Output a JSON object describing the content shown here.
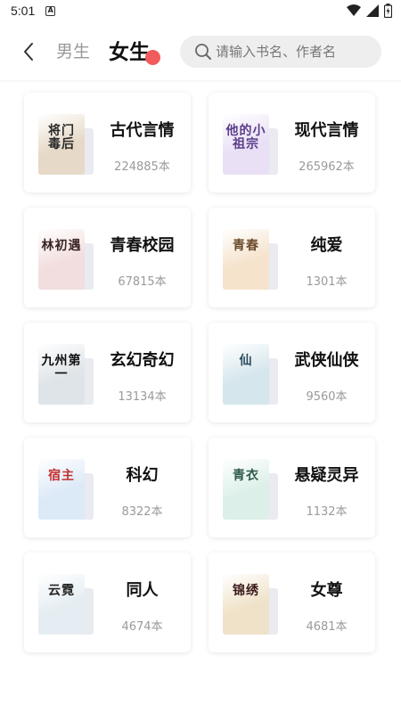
{
  "status_bar": {
    "time": "5:01",
    "notification_icon": "A"
  },
  "header": {
    "tabs": [
      {
        "label": "男生",
        "active": false
      },
      {
        "label": "女生",
        "active": true
      }
    ],
    "search_placeholder": "请输入书名、作者名"
  },
  "categories": [
    {
      "name": "古代言情",
      "count": "224885本",
      "cover_text": "将门\n毒后",
      "cover_bg": "#e6d9c7",
      "cover_ink": "#2a2a2a"
    },
    {
      "name": "现代言情",
      "count": "265962本",
      "cover_text": "他的小祖宗",
      "cover_bg": "#e9e0f5",
      "cover_ink": "#5b3d8a"
    },
    {
      "name": "青春校园",
      "count": "67815本",
      "cover_text": "林初遇",
      "cover_bg": "#f2dede",
      "cover_ink": "#3a2323"
    },
    {
      "name": "纯爱",
      "count": "1301本",
      "cover_text": "青春",
      "cover_bg": "#f5e3cc",
      "cover_ink": "#6a4a2a"
    },
    {
      "name": "玄幻奇幻",
      "count": "13134本",
      "cover_text": "九州第一",
      "cover_bg": "#dfe4e8",
      "cover_ink": "#111"
    },
    {
      "name": "武侠仙侠",
      "count": "9560本",
      "cover_text": "仙",
      "cover_bg": "#d5e6ec",
      "cover_ink": "#2b4a5a"
    },
    {
      "name": "科幻",
      "count": "8322本",
      "cover_text": "宿主",
      "cover_bg": "#dce9f7",
      "cover_ink": "#c12f2f"
    },
    {
      "name": "悬疑灵异",
      "count": "1132本",
      "cover_text": "青衣",
      "cover_bg": "#dcefe8",
      "cover_ink": "#2d5a4a"
    },
    {
      "name": "同人",
      "count": "4674本",
      "cover_text": "云霓",
      "cover_bg": "#e5edf2",
      "cover_ink": "#222"
    },
    {
      "name": "女尊",
      "count": "4681本",
      "cover_text": "锦绣",
      "cover_bg": "#efe2c8",
      "cover_ink": "#3a1a1a"
    }
  ],
  "colors": {
    "accent_dot": "#f25b5b",
    "muted_text": "#9a9a9a"
  }
}
